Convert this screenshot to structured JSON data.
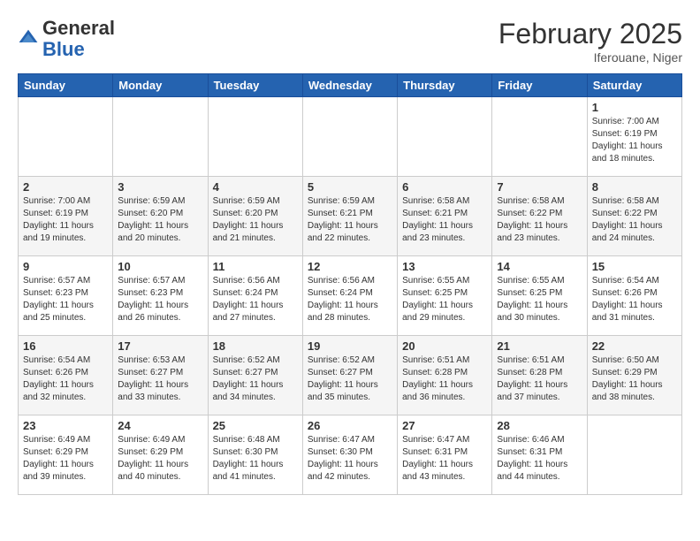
{
  "header": {
    "logo_general": "General",
    "logo_blue": "Blue",
    "month_title": "February 2025",
    "location": "Iferouane, Niger"
  },
  "days_of_week": [
    "Sunday",
    "Monday",
    "Tuesday",
    "Wednesday",
    "Thursday",
    "Friday",
    "Saturday"
  ],
  "weeks": [
    [
      {
        "day": "",
        "info": ""
      },
      {
        "day": "",
        "info": ""
      },
      {
        "day": "",
        "info": ""
      },
      {
        "day": "",
        "info": ""
      },
      {
        "day": "",
        "info": ""
      },
      {
        "day": "",
        "info": ""
      },
      {
        "day": "1",
        "info": "Sunrise: 7:00 AM\nSunset: 6:19 PM\nDaylight: 11 hours\nand 18 minutes."
      }
    ],
    [
      {
        "day": "2",
        "info": "Sunrise: 7:00 AM\nSunset: 6:19 PM\nDaylight: 11 hours\nand 19 minutes."
      },
      {
        "day": "3",
        "info": "Sunrise: 6:59 AM\nSunset: 6:20 PM\nDaylight: 11 hours\nand 20 minutes."
      },
      {
        "day": "4",
        "info": "Sunrise: 6:59 AM\nSunset: 6:20 PM\nDaylight: 11 hours\nand 21 minutes."
      },
      {
        "day": "5",
        "info": "Sunrise: 6:59 AM\nSunset: 6:21 PM\nDaylight: 11 hours\nand 22 minutes."
      },
      {
        "day": "6",
        "info": "Sunrise: 6:58 AM\nSunset: 6:21 PM\nDaylight: 11 hours\nand 23 minutes."
      },
      {
        "day": "7",
        "info": "Sunrise: 6:58 AM\nSunset: 6:22 PM\nDaylight: 11 hours\nand 23 minutes."
      },
      {
        "day": "8",
        "info": "Sunrise: 6:58 AM\nSunset: 6:22 PM\nDaylight: 11 hours\nand 24 minutes."
      }
    ],
    [
      {
        "day": "9",
        "info": "Sunrise: 6:57 AM\nSunset: 6:23 PM\nDaylight: 11 hours\nand 25 minutes."
      },
      {
        "day": "10",
        "info": "Sunrise: 6:57 AM\nSunset: 6:23 PM\nDaylight: 11 hours\nand 26 minutes."
      },
      {
        "day": "11",
        "info": "Sunrise: 6:56 AM\nSunset: 6:24 PM\nDaylight: 11 hours\nand 27 minutes."
      },
      {
        "day": "12",
        "info": "Sunrise: 6:56 AM\nSunset: 6:24 PM\nDaylight: 11 hours\nand 28 minutes."
      },
      {
        "day": "13",
        "info": "Sunrise: 6:55 AM\nSunset: 6:25 PM\nDaylight: 11 hours\nand 29 minutes."
      },
      {
        "day": "14",
        "info": "Sunrise: 6:55 AM\nSunset: 6:25 PM\nDaylight: 11 hours\nand 30 minutes."
      },
      {
        "day": "15",
        "info": "Sunrise: 6:54 AM\nSunset: 6:26 PM\nDaylight: 11 hours\nand 31 minutes."
      }
    ],
    [
      {
        "day": "16",
        "info": "Sunrise: 6:54 AM\nSunset: 6:26 PM\nDaylight: 11 hours\nand 32 minutes."
      },
      {
        "day": "17",
        "info": "Sunrise: 6:53 AM\nSunset: 6:27 PM\nDaylight: 11 hours\nand 33 minutes."
      },
      {
        "day": "18",
        "info": "Sunrise: 6:52 AM\nSunset: 6:27 PM\nDaylight: 11 hours\nand 34 minutes."
      },
      {
        "day": "19",
        "info": "Sunrise: 6:52 AM\nSunset: 6:27 PM\nDaylight: 11 hours\nand 35 minutes."
      },
      {
        "day": "20",
        "info": "Sunrise: 6:51 AM\nSunset: 6:28 PM\nDaylight: 11 hours\nand 36 minutes."
      },
      {
        "day": "21",
        "info": "Sunrise: 6:51 AM\nSunset: 6:28 PM\nDaylight: 11 hours\nand 37 minutes."
      },
      {
        "day": "22",
        "info": "Sunrise: 6:50 AM\nSunset: 6:29 PM\nDaylight: 11 hours\nand 38 minutes."
      }
    ],
    [
      {
        "day": "23",
        "info": "Sunrise: 6:49 AM\nSunset: 6:29 PM\nDaylight: 11 hours\nand 39 minutes."
      },
      {
        "day": "24",
        "info": "Sunrise: 6:49 AM\nSunset: 6:29 PM\nDaylight: 11 hours\nand 40 minutes."
      },
      {
        "day": "25",
        "info": "Sunrise: 6:48 AM\nSunset: 6:30 PM\nDaylight: 11 hours\nand 41 minutes."
      },
      {
        "day": "26",
        "info": "Sunrise: 6:47 AM\nSunset: 6:30 PM\nDaylight: 11 hours\nand 42 minutes."
      },
      {
        "day": "27",
        "info": "Sunrise: 6:47 AM\nSunset: 6:31 PM\nDaylight: 11 hours\nand 43 minutes."
      },
      {
        "day": "28",
        "info": "Sunrise: 6:46 AM\nSunset: 6:31 PM\nDaylight: 11 hours\nand 44 minutes."
      },
      {
        "day": "",
        "info": ""
      }
    ]
  ]
}
